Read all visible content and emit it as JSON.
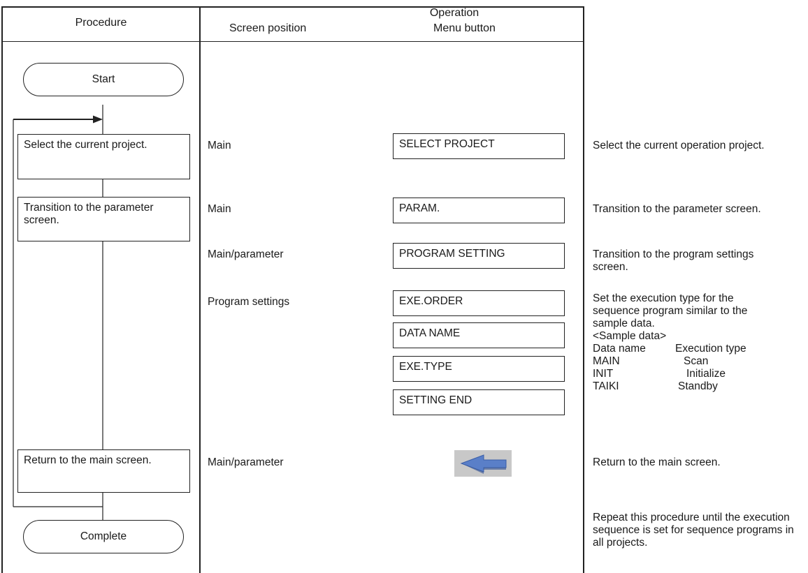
{
  "header": {
    "procedure": "Procedure",
    "operation": "Operation",
    "screen_position": "Screen position",
    "menu_button": "Menu button"
  },
  "flow": {
    "start": "Start",
    "complete": "Complete"
  },
  "steps": [
    {
      "label": "Select the current project.",
      "screen": "Main",
      "button": "SELECT PROJECT",
      "desc": "Select the current operation project."
    },
    {
      "label": "Transition to the parameter screen.",
      "screen": "Main",
      "button": "PARAM.",
      "desc": "Transition to the parameter screen."
    },
    {
      "label": "",
      "screen": "Main/parameter",
      "button": "PROGRAM SETTING",
      "desc": "Transition to the program settings screen."
    },
    {
      "label": "",
      "screen": "Program settings",
      "buttons": [
        "EXE.ORDER",
        "DATA NAME",
        "EXE.TYPE",
        "SETTING END"
      ],
      "desc": "Set the execution type for the sequence program similar to the sample data.",
      "sample_title": "<Sample data>",
      "sample_header": [
        "Data name",
        "Execution type"
      ],
      "sample_rows": [
        [
          "MAIN",
          "Scan"
        ],
        [
          "INIT",
          "Initialize"
        ],
        [
          "TAIKI",
          "Standby"
        ]
      ]
    },
    {
      "label": "Return to the main screen.",
      "screen": "Main/parameter",
      "button_icon": "back-arrow-icon",
      "desc": "Return to the main screen."
    }
  ],
  "repeat_note": "Repeat this procedure until the execution sequence is set for sequence programs in all projects.",
  "colors": {
    "arrow_fill": "#5a7fc8",
    "arrow_bg": "#c8c8c8"
  }
}
